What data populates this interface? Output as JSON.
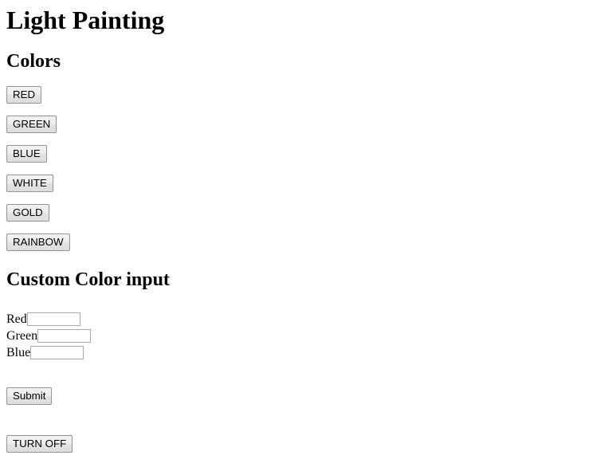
{
  "page": {
    "title": "Light Painting"
  },
  "colors_section": {
    "heading": "Colors",
    "buttons": [
      {
        "label": "RED",
        "name": "red-button"
      },
      {
        "label": "GREEN",
        "name": "green-button"
      },
      {
        "label": "BLUE",
        "name": "blue-button"
      },
      {
        "label": "WHITE",
        "name": "white-button"
      },
      {
        "label": "GOLD",
        "name": "gold-button"
      },
      {
        "label": "RAINBOW",
        "name": "rainbow-button"
      }
    ]
  },
  "custom_color_section": {
    "heading": "Custom Color input",
    "fields": [
      {
        "label": "Red",
        "value": "",
        "placeholder": ""
      },
      {
        "label": "Green",
        "value": "",
        "placeholder": ""
      },
      {
        "label": "Blue",
        "value": "",
        "placeholder": ""
      }
    ],
    "submit_label": "Submit"
  },
  "power": {
    "turn_off_label": "TURN OFF"
  },
  "theme": {
    "background": "#ffffff",
    "text": "#000000",
    "button_face": "#ededed",
    "button_border": "#949494",
    "input_border": "#a9a9a9"
  }
}
